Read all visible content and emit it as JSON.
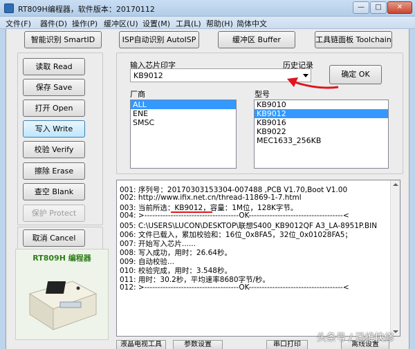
{
  "window": {
    "title": "RT809H编程器，软件版本：20170112",
    "controls": {
      "minimize": "—",
      "maximize": "□",
      "close": "✕"
    }
  },
  "menu": [
    "文件(F)",
    "器件(D)",
    "操作(P)",
    "缓冲区(U)",
    "设置(M)",
    "工具(L)",
    "帮助(H)",
    "简体中文"
  ],
  "toolbar": {
    "smartid": "智能识别 SmartID",
    "autoisp": "ISP自动识别 AutoISP",
    "buffer": "缓冲区 Buffer",
    "toolchain": "工具链面板 Toolchain"
  },
  "actions": {
    "read": "读取 Read",
    "save": "保存 Save",
    "open": "打开 Open",
    "write": "写入 Write",
    "verify": "校验 Verify",
    "erase": "擦除 Erase",
    "blank": "查空 Blank",
    "protect": "保护 Protect",
    "cancel": "取消 Cancel"
  },
  "chip_input": {
    "label": "输入芯片印字",
    "history_label": "历史记录",
    "value": "KB9012",
    "confirm": "确定 OK"
  },
  "vendor": {
    "label": "厂商",
    "items": [
      {
        "label": "ALL",
        "selected": true
      },
      {
        "label": "ENE",
        "selected": false
      },
      {
        "label": "SMSC",
        "selected": false
      }
    ]
  },
  "model": {
    "label": "型号",
    "items": [
      {
        "label": "KB9010",
        "selected": false
      },
      {
        "label": "KB9012",
        "selected": true
      },
      {
        "label": "KB9016",
        "selected": false
      },
      {
        "label": "KB9022",
        "selected": false
      },
      {
        "label": "MEC1633_256KB",
        "selected": false
      }
    ]
  },
  "log": [
    "001: 序列号：20170303153304-007488 ,PCB V1.70,Boot V1.00",
    "002: http://www.ifix.net.cn/thread-11869-1-7.html",
    "003: 当前所选：KB9012，容量：1M位，128K字节。",
    "004: >------------------------------------OK------------------------------------<",
    "005: C:\\USERS\\LUCON\\DESKTOP\\联想S400_KB9012QF A3_LA-8951P.BIN",
    "006: 文件已载入，累加校验和：16位_0x8FA5，32位_0x01028FA5；",
    "007: 开始写入芯片......",
    "008: 写入成功，用时：26.64秒。",
    "009: 自动校验...",
    "010: 校验完成，用时：3.548秒。",
    "011: 用时：30.2秒，平均速率8680字节/秒。",
    "012: >------------------------------------OK------------------------------------<"
  ],
  "photo": {
    "title": "RT809H 编程器"
  },
  "bottom_tabs": [
    "液晶电视工具",
    "参数设置",
    "串口打印",
    "离线设置"
  ],
  "watermark": "头条号 / 迅维快修",
  "colors": {
    "selection": "#3399ff",
    "annotation": "#e0141c",
    "frame": "#bcd4ec"
  }
}
